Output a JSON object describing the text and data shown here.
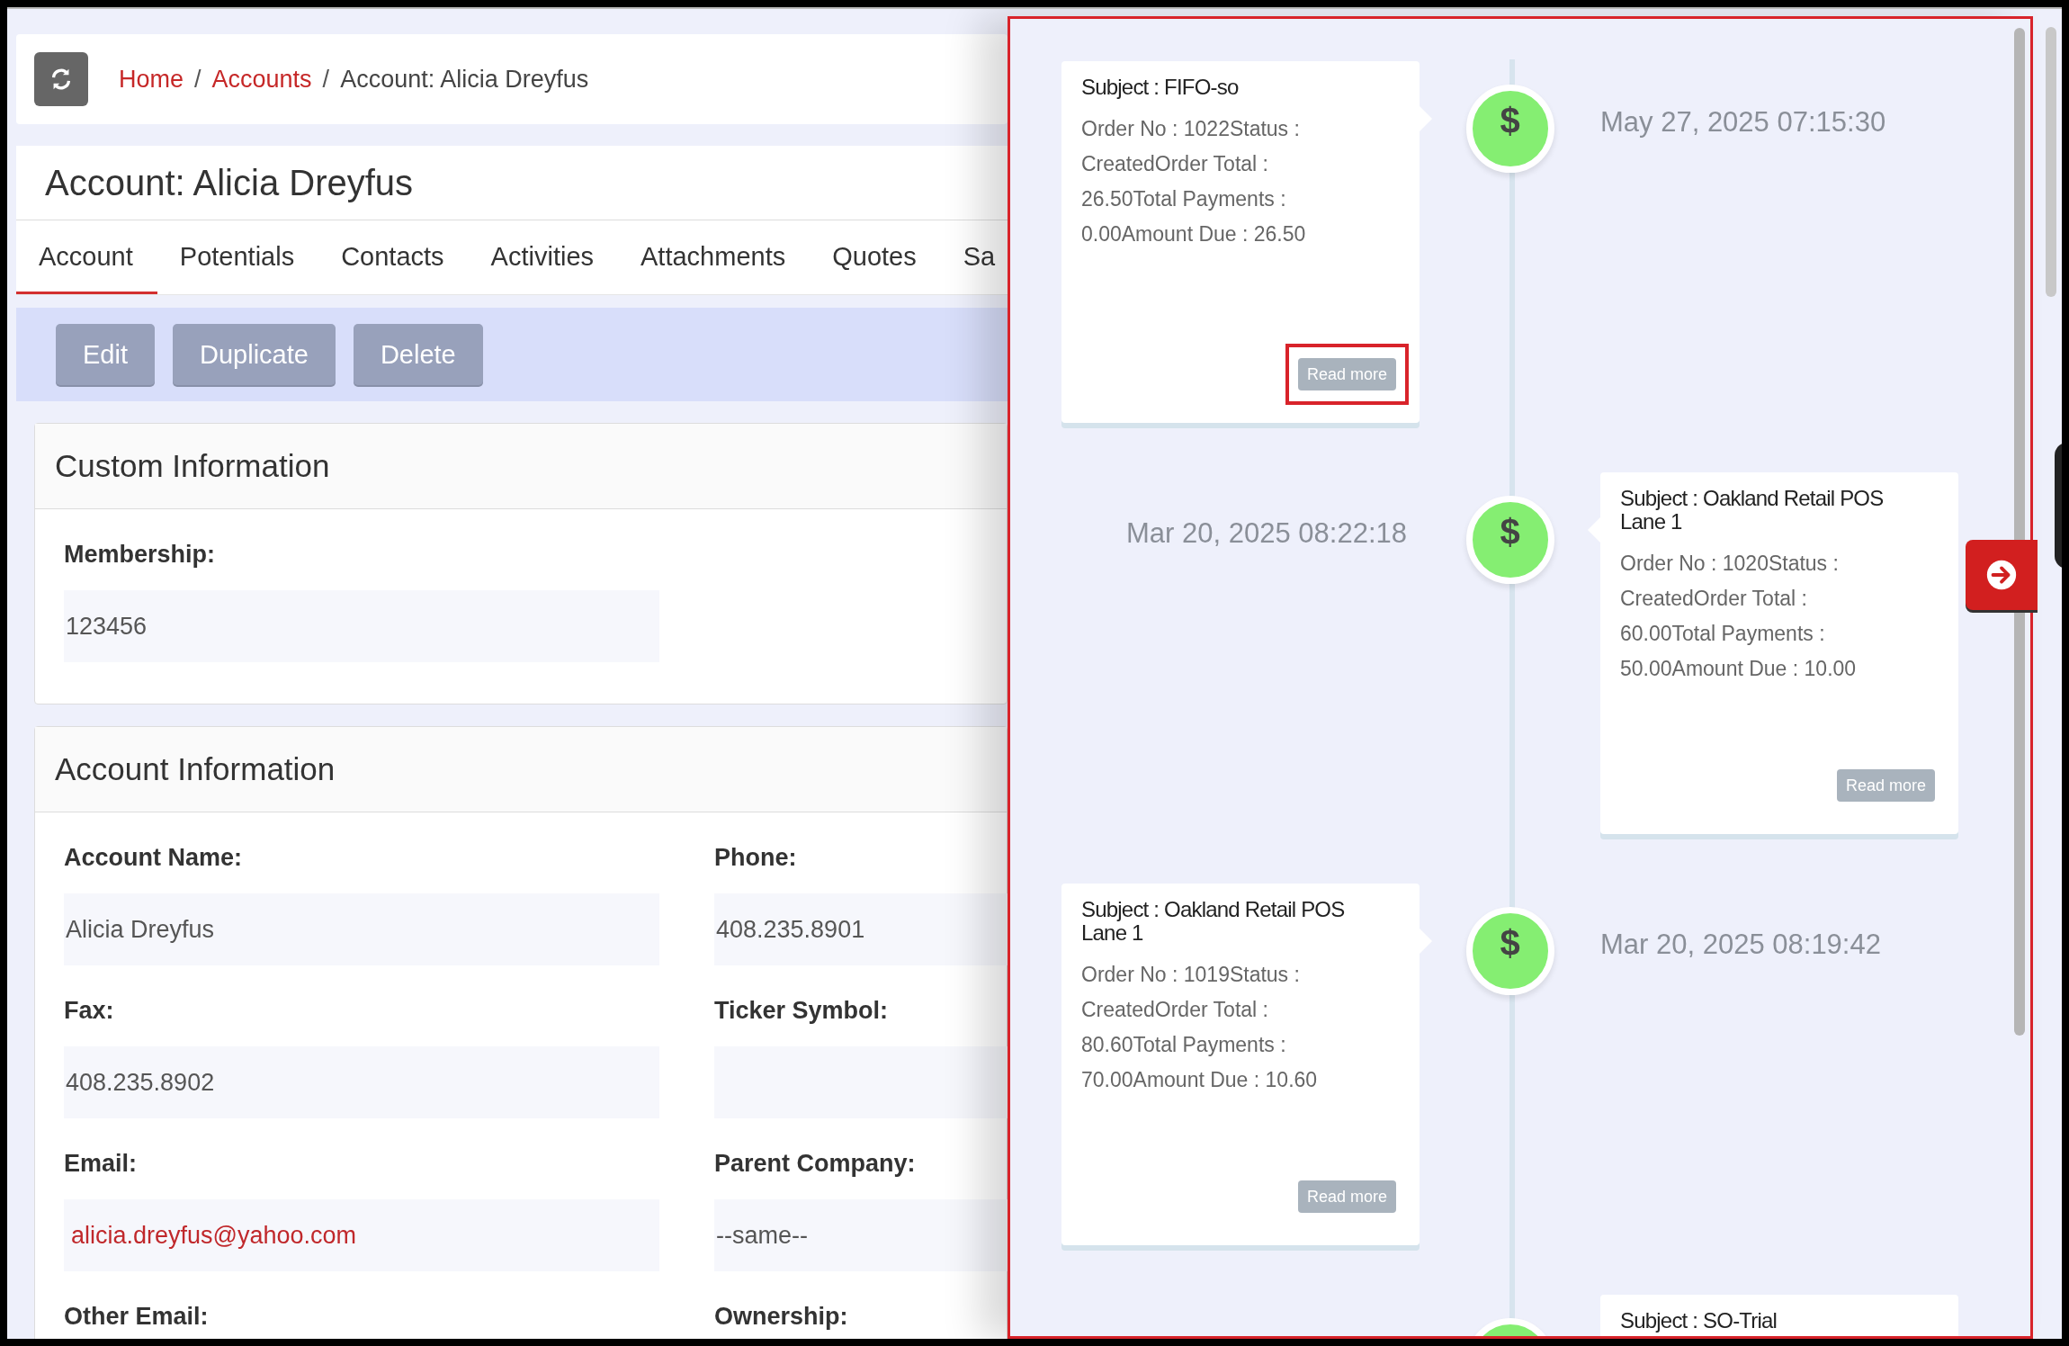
{
  "breadcrumb": {
    "separator": "/",
    "items": [
      {
        "label": "Home",
        "link": true
      },
      {
        "label": "Accounts",
        "link": true
      },
      {
        "label": "Account: Alicia Dreyfus",
        "link": false
      }
    ]
  },
  "page_title": "Account: Alicia Dreyfus",
  "tabs": [
    {
      "label": "Account",
      "selected": true
    },
    {
      "label": "Potentials",
      "selected": false
    },
    {
      "label": "Contacts",
      "selected": false
    },
    {
      "label": "Activities",
      "selected": false
    },
    {
      "label": "Attachments",
      "selected": false
    },
    {
      "label": "Quotes",
      "selected": false
    },
    {
      "label": "Sa",
      "selected": false
    }
  ],
  "actions": [
    "Edit",
    "Duplicate",
    "Delete"
  ],
  "sections": [
    {
      "title": "Custom Information",
      "fields": [
        {
          "label": "Membership:",
          "value": "123456"
        }
      ]
    },
    {
      "title": "Account Information",
      "fields": [
        {
          "label": "Account Name:",
          "value": "Alicia Dreyfus"
        },
        {
          "label": "Phone:",
          "value": "408.235.8901"
        },
        {
          "label": "Fax:",
          "value": "408.235.8902"
        },
        {
          "label": "Ticker Symbol:",
          "empty_box": true
        },
        {
          "label": "Email:",
          "value": "alicia.dreyfus@yahoo.com",
          "link": true
        },
        {
          "label": "Parent Company:",
          "value": "--same--"
        },
        {
          "label": "Other Email:"
        },
        {
          "label": "Ownership:"
        }
      ]
    }
  ],
  "timeline": {
    "entries": [
      {
        "icon": "$",
        "subject": "Subject : FIFO-so",
        "lines": [
          "Order No : 1022Status :",
          "CreatedOrder Total :",
          "26.50Total Payments :",
          "0.00Amount Due : 26.50"
        ],
        "button": "Read more",
        "highlighted": true,
        "date": "May 27, 2025 07:15:30"
      },
      {
        "icon": "$",
        "subject": "Subject : Oakland Retail POS Lane 1",
        "lines": [
          "Order No : 1020Status :",
          "CreatedOrder Total :",
          "60.00Total Payments :",
          "50.00Amount Due : 10.00"
        ],
        "button": "Read more",
        "highlighted": false,
        "date": "Mar 20, 2025 08:22:18"
      },
      {
        "icon": "$",
        "subject": "Subject : Oakland Retail POS Lane 1",
        "lines": [
          "Order No : 1019Status :",
          "CreatedOrder Total :",
          "80.60Total Payments :",
          "70.00Amount Due : 10.60"
        ],
        "button": "Read more",
        "highlighted": false,
        "date": "Mar 20, 2025 08:19:42"
      },
      {
        "subject": "Subject : SO-Trial"
      }
    ]
  }
}
